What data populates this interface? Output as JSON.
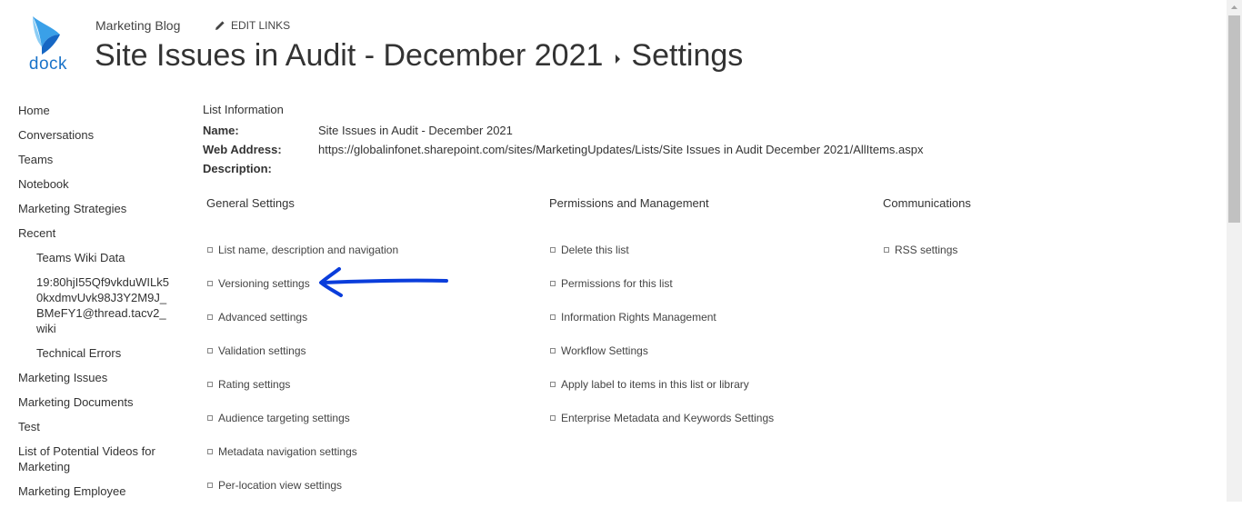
{
  "logo": {
    "text": "dock",
    "icon": "dock-logo-icon",
    "color": "#1a73c9"
  },
  "header": {
    "site_name": "Marketing Blog",
    "edit_links": "EDIT LINKS",
    "title_list": "Site Issues in Audit - December 2021",
    "title_page": "Settings"
  },
  "nav": {
    "items": [
      "Home",
      "Conversations",
      "Teams",
      "Notebook",
      "Marketing Strategies",
      "Recent"
    ],
    "recent_items": [
      "Teams Wiki Data",
      "19:80hjI55Qf9vkduWILk50kxdmvUvk98J3Y2M9J_BMeFY1@thread.tacv2_wiki",
      "Technical Errors"
    ],
    "more_items": [
      "Marketing Issues",
      "Marketing Documents",
      "Test",
      "List of Potential Videos for Marketing",
      "Marketing Employee"
    ]
  },
  "list_info": {
    "caption": "List Information",
    "name_label": "Name:",
    "name_value": "Site Issues in Audit - December 2021",
    "web_label": "Web Address:",
    "web_value": "https://globalinfonet.sharepoint.com/sites/MarketingUpdates/Lists/Site Issues in Audit December 2021/AllItems.aspx",
    "desc_label": "Description:",
    "desc_value": ""
  },
  "general": {
    "heading": "General Settings",
    "links": [
      "List name, description and navigation",
      "Versioning settings",
      "Advanced settings",
      "Validation settings",
      "Rating settings",
      "Audience targeting settings",
      "Metadata navigation settings",
      "Per-location view settings"
    ]
  },
  "permissions": {
    "heading": "Permissions and Management",
    "links": [
      "Delete this list",
      "Permissions for this list",
      "Information Rights Management",
      "Workflow Settings",
      "Apply label to items in this list or library",
      "Enterprise Metadata and Keywords Settings"
    ]
  },
  "communications": {
    "heading": "Communications",
    "links": [
      "RSS settings"
    ]
  },
  "annotation": {
    "icon": "arrow-left-annotation-icon",
    "color": "#0a3ddb"
  }
}
